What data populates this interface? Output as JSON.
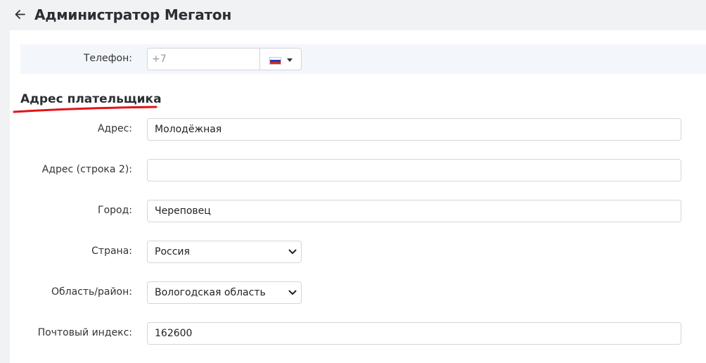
{
  "header": {
    "title": "Администратор Мегатон"
  },
  "phone": {
    "label": "Телефон:",
    "placeholder": "+7",
    "country_flag": "russia-flag-icon"
  },
  "billing": {
    "section_title": "Адрес плательщика",
    "address_label": "Адрес:",
    "address_value": "Молодёжная",
    "address2_label": "Адрес (строка 2):",
    "address2_value": "",
    "city_label": "Город:",
    "city_value": "Череповец",
    "country_label": "Страна:",
    "country_value": "Россия",
    "region_label": "Область/район:",
    "region_value": "Вологодская область",
    "zip_label": "Почтовый индекс:",
    "zip_value": "162600"
  },
  "colors": {
    "annotation_underline": "#e3141b",
    "header_bg": "#f1f2f4",
    "phone_row_bg": "#f3f6fb"
  }
}
